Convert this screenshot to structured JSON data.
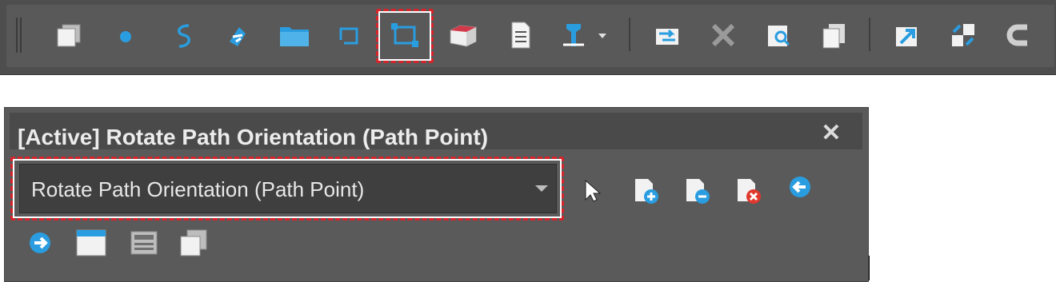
{
  "toolbar": {
    "icons": [
      "window-stack-icon",
      "point-dot-icon",
      "curve-s-icon",
      "rotate-arrow-icon",
      "folder-icon",
      "open-path-icon",
      "path-rectangle-icon",
      "red-box-icon",
      "document-icon",
      "tool-dropdown-icon",
      "swap-arrow-icon",
      "delete-x-icon",
      "search-document-icon",
      "copy-pages-icon",
      "diagonal-arrow-icon",
      "transfer-arrows-icon",
      "magnet-c-icon"
    ],
    "highlighted": "path-rectangle-icon"
  },
  "panel": {
    "title": "[Active] Rotate Path Orientation (Path Point)",
    "close_label": "✕",
    "combo": {
      "value": "Rotate Path Orientation (Path Point)"
    },
    "buttons": [
      "pointer-arrow-icon",
      "add-point-icon",
      "remove-point-icon",
      "delete-point-icon",
      "previous-arrow-icon",
      "next-arrow-icon",
      "window-icon",
      "grid-panel-icon",
      "copy-window-icon"
    ]
  },
  "colors": {
    "highlight": "#d8232a",
    "accent_blue": "#2a9de0",
    "panel_bg": "#5a5a5a",
    "toolbar_bg": "#595959"
  }
}
